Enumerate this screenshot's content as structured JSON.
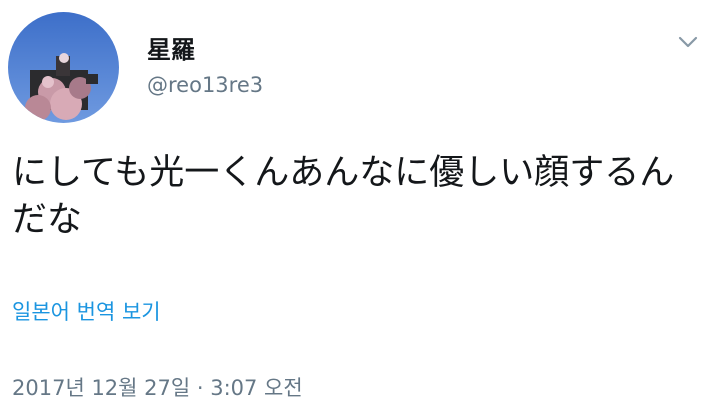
{
  "author": {
    "display_name": "星羅",
    "handle": "@reo13re3"
  },
  "tweet": {
    "text": "にしても光一くんあんなに優しい顔するん\nだな"
  },
  "translate": {
    "label": "일본어 번역 보기"
  },
  "meta": {
    "timestamp": "2017년 12월 27일 · 3:07 오전"
  },
  "icons": {
    "menu": "chevron-down-icon"
  },
  "colors": {
    "text": "#14171a",
    "secondary": "#657786",
    "link": "#1b95e0"
  }
}
